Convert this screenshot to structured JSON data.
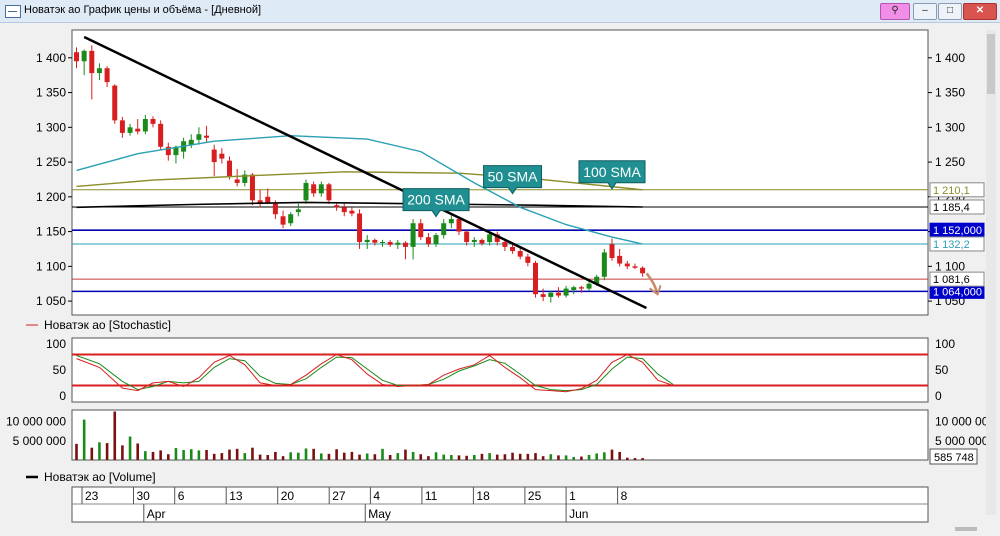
{
  "window": {
    "title": "Новатэк ао График цены и объёма - [Дневной]",
    "buttons": {
      "pin": "⚲",
      "minimize": "–",
      "maximize": "□",
      "close": "✕"
    }
  },
  "chart_data": [
    {
      "type": "candlestick",
      "title": "",
      "ylim": [
        1030,
        1440
      ],
      "y_ticks": [
        1050,
        1100,
        1150,
        1200,
        1250,
        1300,
        1350,
        1400
      ],
      "y_tick_labels": [
        "1 050",
        "1 100",
        "1 150",
        "1 200",
        "1 250",
        "1 300",
        "1 350",
        "1 400"
      ],
      "candles": [
        {
          "o": 1408,
          "h": 1415,
          "l": 1385,
          "c": 1395
        },
        {
          "o": 1395,
          "h": 1412,
          "l": 1375,
          "c": 1410
        },
        {
          "o": 1410,
          "h": 1418,
          "l": 1340,
          "c": 1378
        },
        {
          "o": 1378,
          "h": 1392,
          "l": 1368,
          "c": 1385
        },
        {
          "o": 1385,
          "h": 1388,
          "l": 1358,
          "c": 1365
        },
        {
          "o": 1360,
          "h": 1362,
          "l": 1305,
          "c": 1310
        },
        {
          "o": 1310,
          "h": 1315,
          "l": 1285,
          "c": 1292
        },
        {
          "o": 1292,
          "h": 1305,
          "l": 1288,
          "c": 1300
        },
        {
          "o": 1298,
          "h": 1312,
          "l": 1290,
          "c": 1294
        },
        {
          "o": 1294,
          "h": 1318,
          "l": 1290,
          "c": 1312
        },
        {
          "o": 1312,
          "h": 1316,
          "l": 1300,
          "c": 1305
        },
        {
          "o": 1305,
          "h": 1310,
          "l": 1268,
          "c": 1272
        },
        {
          "o": 1272,
          "h": 1278,
          "l": 1252,
          "c": 1260
        },
        {
          "o": 1260,
          "h": 1274,
          "l": 1248,
          "c": 1272
        },
        {
          "o": 1265,
          "h": 1285,
          "l": 1255,
          "c": 1280
        },
        {
          "o": 1275,
          "h": 1290,
          "l": 1270,
          "c": 1282
        },
        {
          "o": 1282,
          "h": 1300,
          "l": 1275,
          "c": 1290
        },
        {
          "o": 1288,
          "h": 1302,
          "l": 1278,
          "c": 1285
        },
        {
          "o": 1268,
          "h": 1275,
          "l": 1230,
          "c": 1250
        },
        {
          "o": 1262,
          "h": 1270,
          "l": 1248,
          "c": 1255
        },
        {
          "o": 1252,
          "h": 1258,
          "l": 1225,
          "c": 1230
        },
        {
          "o": 1225,
          "h": 1240,
          "l": 1215,
          "c": 1220
        },
        {
          "o": 1220,
          "h": 1238,
          "l": 1215,
          "c": 1232
        },
        {
          "o": 1232,
          "h": 1234,
          "l": 1188,
          "c": 1195
        },
        {
          "o": 1195,
          "h": 1210,
          "l": 1185,
          "c": 1190
        },
        {
          "o": 1200,
          "h": 1212,
          "l": 1190,
          "c": 1192
        },
        {
          "o": 1190,
          "h": 1195,
          "l": 1168,
          "c": 1175
        },
        {
          "o": 1172,
          "h": 1180,
          "l": 1155,
          "c": 1160
        },
        {
          "o": 1162,
          "h": 1178,
          "l": 1158,
          "c": 1175
        },
        {
          "o": 1178,
          "h": 1190,
          "l": 1172,
          "c": 1182
        },
        {
          "o": 1195,
          "h": 1225,
          "l": 1190,
          "c": 1220
        },
        {
          "o": 1218,
          "h": 1222,
          "l": 1200,
          "c": 1205
        },
        {
          "o": 1205,
          "h": 1222,
          "l": 1200,
          "c": 1218
        },
        {
          "o": 1218,
          "h": 1220,
          "l": 1190,
          "c": 1195
        },
        {
          "o": 1188,
          "h": 1192,
          "l": 1180,
          "c": 1185
        },
        {
          "o": 1185,
          "h": 1190,
          "l": 1172,
          "c": 1178
        },
        {
          "o": 1180,
          "h": 1185,
          "l": 1172,
          "c": 1176
        },
        {
          "o": 1176,
          "h": 1182,
          "l": 1125,
          "c": 1135
        },
        {
          "o": 1135,
          "h": 1145,
          "l": 1125,
          "c": 1138
        },
        {
          "o": 1138,
          "h": 1140,
          "l": 1130,
          "c": 1134
        },
        {
          "o": 1134,
          "h": 1138,
          "l": 1128,
          "c": 1135
        },
        {
          "o": 1135,
          "h": 1138,
          "l": 1128,
          "c": 1131
        },
        {
          "o": 1131,
          "h": 1138,
          "l": 1125,
          "c": 1134
        },
        {
          "o": 1134,
          "h": 1136,
          "l": 1110,
          "c": 1128
        },
        {
          "o": 1128,
          "h": 1168,
          "l": 1110,
          "c": 1162
        },
        {
          "o": 1162,
          "h": 1168,
          "l": 1138,
          "c": 1142
        },
        {
          "o": 1142,
          "h": 1148,
          "l": 1128,
          "c": 1132
        },
        {
          "o": 1132,
          "h": 1148,
          "l": 1128,
          "c": 1145
        },
        {
          "o": 1145,
          "h": 1168,
          "l": 1140,
          "c": 1162
        },
        {
          "o": 1162,
          "h": 1175,
          "l": 1155,
          "c": 1168
        },
        {
          "o": 1168,
          "h": 1172,
          "l": 1145,
          "c": 1150
        },
        {
          "o": 1150,
          "h": 1152,
          "l": 1130,
          "c": 1135
        },
        {
          "o": 1135,
          "h": 1142,
          "l": 1128,
          "c": 1138
        },
        {
          "o": 1138,
          "h": 1140,
          "l": 1130,
          "c": 1133
        },
        {
          "o": 1135,
          "h": 1150,
          "l": 1130,
          "c": 1146
        },
        {
          "o": 1146,
          "h": 1150,
          "l": 1130,
          "c": 1135
        },
        {
          "o": 1135,
          "h": 1140,
          "l": 1122,
          "c": 1128
        },
        {
          "o": 1128,
          "h": 1132,
          "l": 1118,
          "c": 1122
        },
        {
          "o": 1122,
          "h": 1126,
          "l": 1110,
          "c": 1114
        },
        {
          "o": 1114,
          "h": 1118,
          "l": 1100,
          "c": 1105
        },
        {
          "o": 1105,
          "h": 1108,
          "l": 1055,
          "c": 1060
        },
        {
          "o": 1060,
          "h": 1068,
          "l": 1050,
          "c": 1056
        },
        {
          "o": 1056,
          "h": 1065,
          "l": 1048,
          "c": 1062
        },
        {
          "o": 1062,
          "h": 1070,
          "l": 1055,
          "c": 1058
        },
        {
          "o": 1058,
          "h": 1072,
          "l": 1055,
          "c": 1068
        },
        {
          "o": 1066,
          "h": 1072,
          "l": 1060,
          "c": 1070
        },
        {
          "o": 1070,
          "h": 1072,
          "l": 1062,
          "c": 1068
        },
        {
          "o": 1068,
          "h": 1078,
          "l": 1065,
          "c": 1075
        },
        {
          "o": 1075,
          "h": 1088,
          "l": 1072,
          "c": 1085
        },
        {
          "o": 1085,
          "h": 1125,
          "l": 1080,
          "c": 1120
        },
        {
          "o": 1132,
          "h": 1140,
          "l": 1108,
          "c": 1112
        },
        {
          "o": 1115,
          "h": 1125,
          "l": 1100,
          "c": 1104
        },
        {
          "o": 1104,
          "h": 1108,
          "l": 1096,
          "c": 1100
        },
        {
          "o": 1100,
          "h": 1104,
          "l": 1096,
          "c": 1098
        },
        {
          "o": 1098,
          "h": 1100,
          "l": 1085,
          "c": 1090
        }
      ],
      "sma200": [
        [
          0,
          1185
        ],
        [
          15,
          1189
        ],
        [
          30,
          1192
        ],
        [
          45,
          1190
        ],
        [
          60,
          1188
        ],
        [
          74,
          1185.4
        ]
      ],
      "sma100": [
        [
          0,
          1215
        ],
        [
          10,
          1224
        ],
        [
          22,
          1230
        ],
        [
          35,
          1236
        ],
        [
          50,
          1234
        ],
        [
          60,
          1226
        ],
        [
          74,
          1210.1
        ]
      ],
      "sma50": [
        [
          0,
          1238
        ],
        [
          8,
          1262
        ],
        [
          18,
          1280
        ],
        [
          28,
          1288
        ],
        [
          38,
          1283
        ],
        [
          45,
          1265
        ],
        [
          52,
          1220
        ],
        [
          58,
          1185
        ],
        [
          64,
          1160
        ],
        [
          70,
          1142
        ],
        [
          74,
          1132.2
        ]
      ],
      "trendline": [
        [
          1,
          1430
        ],
        [
          74.5,
          1040
        ]
      ],
      "hlines": [
        {
          "value": 1152.0,
          "label": "1 152,000",
          "color": "#0000b0",
          "box": "#0000cc",
          "text_color": "#ffffff"
        },
        {
          "value": 1064.0,
          "label": "1 064,000",
          "color": "#0000b0",
          "box": "#0000cc",
          "text_color": "#ffffff"
        },
        {
          "value": 1185.4,
          "label": "1 185,4",
          "color": "#000000",
          "box": "#ffffff",
          "text_color": "#000000"
        },
        {
          "value": 1210.1,
          "label": "1 210,1",
          "color": "#8c8c2a",
          "box": "#ffffff",
          "text_color": "#8c8c2a"
        },
        {
          "value": 1132.2,
          "label": "1 132,2",
          "color": "#2aa0b4",
          "box": "#ffffff",
          "text_color": "#2aa0b4"
        },
        {
          "value": 1081.6,
          "label": "1 081,6",
          "color": "#c83c3c",
          "box": "#ffffff",
          "text_color": "#000000"
        }
      ],
      "annotations": [
        {
          "text": "200 SMA",
          "x": 47,
          "y": 1196
        },
        {
          "text": "50 SMA",
          "x": 57,
          "y": 1229
        },
        {
          "text": "100 SMA",
          "x": 70,
          "y": 1236
        }
      ],
      "colors": {
        "up": "#1a8a1a",
        "down": "#d81e1e",
        "sma200": "#000000",
        "sma100": "#8c8c2a",
        "sma50": "#2aa0b4",
        "trendline": "#000000"
      }
    },
    {
      "type": "line",
      "title": "Новатэк ао [Stochastic]",
      "legend_label": "Новатэк ао [Stochastic]",
      "ylim": [
        -12,
        112
      ],
      "y_ticks": [
        0,
        50,
        100
      ],
      "y_tick_labels": [
        "0",
        "50",
        "100"
      ],
      "levels": [
        80,
        20
      ],
      "k_line": [
        [
          0,
          72
        ],
        [
          3,
          55
        ],
        [
          6,
          15
        ],
        [
          8,
          10
        ],
        [
          10,
          25
        ],
        [
          12,
          28
        ],
        [
          14,
          18
        ],
        [
          16,
          35
        ],
        [
          18,
          65
        ],
        [
          20,
          78
        ],
        [
          22,
          60
        ],
        [
          24,
          25
        ],
        [
          26,
          20
        ],
        [
          28,
          22
        ],
        [
          30,
          40
        ],
        [
          32,
          62
        ],
        [
          34,
          80
        ],
        [
          36,
          70
        ],
        [
          38,
          42
        ],
        [
          40,
          22
        ],
        [
          42,
          18
        ],
        [
          44,
          20
        ],
        [
          46,
          22
        ],
        [
          48,
          40
        ],
        [
          50,
          52
        ],
        [
          52,
          60
        ],
        [
          54,
          78
        ],
        [
          56,
          55
        ],
        [
          58,
          35
        ],
        [
          60,
          12
        ],
        [
          62,
          10
        ],
        [
          64,
          8
        ],
        [
          66,
          14
        ],
        [
          68,
          30
        ],
        [
          70,
          65
        ],
        [
          72,
          80
        ],
        [
          74,
          65
        ],
        [
          76,
          30
        ],
        [
          78,
          20
        ]
      ],
      "d_line": [
        [
          0,
          78
        ],
        [
          3,
          62
        ],
        [
          6,
          28
        ],
        [
          8,
          12
        ],
        [
          10,
          18
        ],
        [
          12,
          28
        ],
        [
          14,
          25
        ],
        [
          16,
          28
        ],
        [
          18,
          55
        ],
        [
          20,
          72
        ],
        [
          22,
          68
        ],
        [
          24,
          38
        ],
        [
          26,
          24
        ],
        [
          28,
          22
        ],
        [
          30,
          33
        ],
        [
          32,
          55
        ],
        [
          34,
          75
        ],
        [
          36,
          74
        ],
        [
          38,
          52
        ],
        [
          40,
          30
        ],
        [
          42,
          20
        ],
        [
          44,
          20
        ],
        [
          46,
          22
        ],
        [
          48,
          32
        ],
        [
          50,
          48
        ],
        [
          52,
          58
        ],
        [
          54,
          70
        ],
        [
          56,
          63
        ],
        [
          58,
          42
        ],
        [
          60,
          20
        ],
        [
          62,
          12
        ],
        [
          64,
          10
        ],
        [
          66,
          12
        ],
        [
          68,
          22
        ],
        [
          70,
          52
        ],
        [
          72,
          75
        ],
        [
          74,
          72
        ],
        [
          76,
          42
        ],
        [
          78,
          22
        ]
      ],
      "colors": {
        "k": "#d81e1e",
        "d": "#1a8a1a",
        "level": "#d81e1e"
      }
    },
    {
      "type": "bar",
      "title": "Новатэк ао [Volume]",
      "legend_label": "Новатэк ао [Volume]",
      "ylim": [
        0,
        13000000
      ],
      "y_ticks": [
        5000000,
        10000000
      ],
      "y_tick_labels": [
        "5 000 000",
        "10 000 000"
      ],
      "last_value_label": "585 748",
      "values": [
        4200000,
        10500000,
        3200000,
        4600000,
        4400000,
        12600000,
        3800000,
        6100000,
        4300000,
        2300000,
        2100000,
        2500000,
        1500000,
        3100000,
        2600000,
        2800000,
        2500000,
        2600000,
        1600000,
        1800000,
        2700000,
        2900000,
        1800000,
        3200000,
        1400000,
        1300000,
        2100000,
        1000000,
        2000000,
        1900000,
        3000000,
        2900000,
        1700000,
        1600000,
        2800000,
        1900000,
        2100000,
        1400000,
        1700000,
        1500000,
        2900000,
        1300000,
        1800000,
        2700000,
        2100000,
        1500000,
        1000000,
        2000000,
        1400000,
        1300000,
        1200000,
        1100000,
        1300000,
        1600000,
        1800000,
        1400000,
        1500000,
        1900000,
        1600000,
        1600000,
        1800000,
        1000000,
        1500000,
        1200000,
        1200000,
        800000,
        900000,
        1300000,
        1700000,
        2000000,
        2700000,
        2100000,
        600000,
        500000,
        500000
      ],
      "colors": {
        "up": "#1a8a1a",
        "down": "#7a1010"
      }
    }
  ],
  "x_axis": {
    "day_labels": [
      {
        "text": "23",
        "idx": 1
      },
      {
        "text": "30",
        "idx": 6
      },
      {
        "text": "6",
        "idx": 10
      },
      {
        "text": "13",
        "idx": 15
      },
      {
        "text": "20",
        "idx": 20
      },
      {
        "text": "27",
        "idx": 25
      },
      {
        "text": "4",
        "idx": 29
      },
      {
        "text": "11",
        "idx": 34
      },
      {
        "text": "18",
        "idx": 39
      },
      {
        "text": "25",
        "idx": 44
      },
      {
        "text": "1",
        "idx": 48
      },
      {
        "text": "8",
        "idx": 53
      }
    ],
    "month_labels": [
      {
        "text": "Apr",
        "idx": 7
      },
      {
        "text": "May",
        "idx": 28.5
      },
      {
        "text": "Jun",
        "idx": 48
      }
    ]
  }
}
